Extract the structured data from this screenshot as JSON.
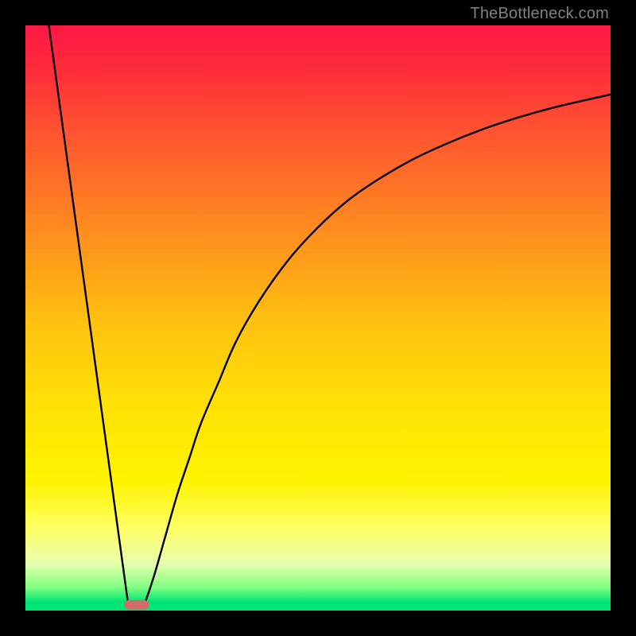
{
  "watermark": "TheBottleneck.com",
  "chart_data": {
    "type": "line",
    "title": "",
    "xlabel": "",
    "ylabel": "",
    "xlim": [
      0,
      100
    ],
    "ylim": [
      0,
      100
    ],
    "gradient_stops": [
      {
        "offset": 0.0,
        "color": "#ff1744"
      },
      {
        "offset": 0.07,
        "color": "#ff2a3c"
      },
      {
        "offset": 0.2,
        "color": "#ff5a2e"
      },
      {
        "offset": 0.35,
        "color": "#ff8c1f"
      },
      {
        "offset": 0.5,
        "color": "#ffbf10"
      },
      {
        "offset": 0.65,
        "color": "#ffe205"
      },
      {
        "offset": 0.78,
        "color": "#fff400"
      },
      {
        "offset": 0.86,
        "color": "#ffff66"
      },
      {
        "offset": 0.92,
        "color": "#e8ffb0"
      },
      {
        "offset": 0.96,
        "color": "#80ff80"
      },
      {
        "offset": 0.985,
        "color": "#00e676"
      },
      {
        "offset": 1.0,
        "color": "#00e676"
      }
    ],
    "series": [
      {
        "name": "left-line",
        "x": [
          4.0,
          17.5
        ],
        "y": [
          100.0,
          1.5
        ]
      },
      {
        "name": "right-curve",
        "x": [
          20.5,
          22,
          24,
          26,
          28,
          30,
          33,
          36,
          40,
          45,
          50,
          55,
          60,
          66,
          72,
          78,
          84,
          90,
          96,
          100
        ],
        "y": [
          1.5,
          6,
          13,
          20,
          26,
          32,
          39,
          46,
          53,
          60,
          65.5,
          70,
          73.5,
          77,
          79.8,
          82.2,
          84.2,
          85.9,
          87.3,
          88.2
        ]
      }
    ],
    "marker": {
      "cx": 19.0,
      "cy": 1.0,
      "width": 4.2,
      "height": 1.6,
      "rx": 0.8,
      "color": "#d46a6a"
    }
  }
}
